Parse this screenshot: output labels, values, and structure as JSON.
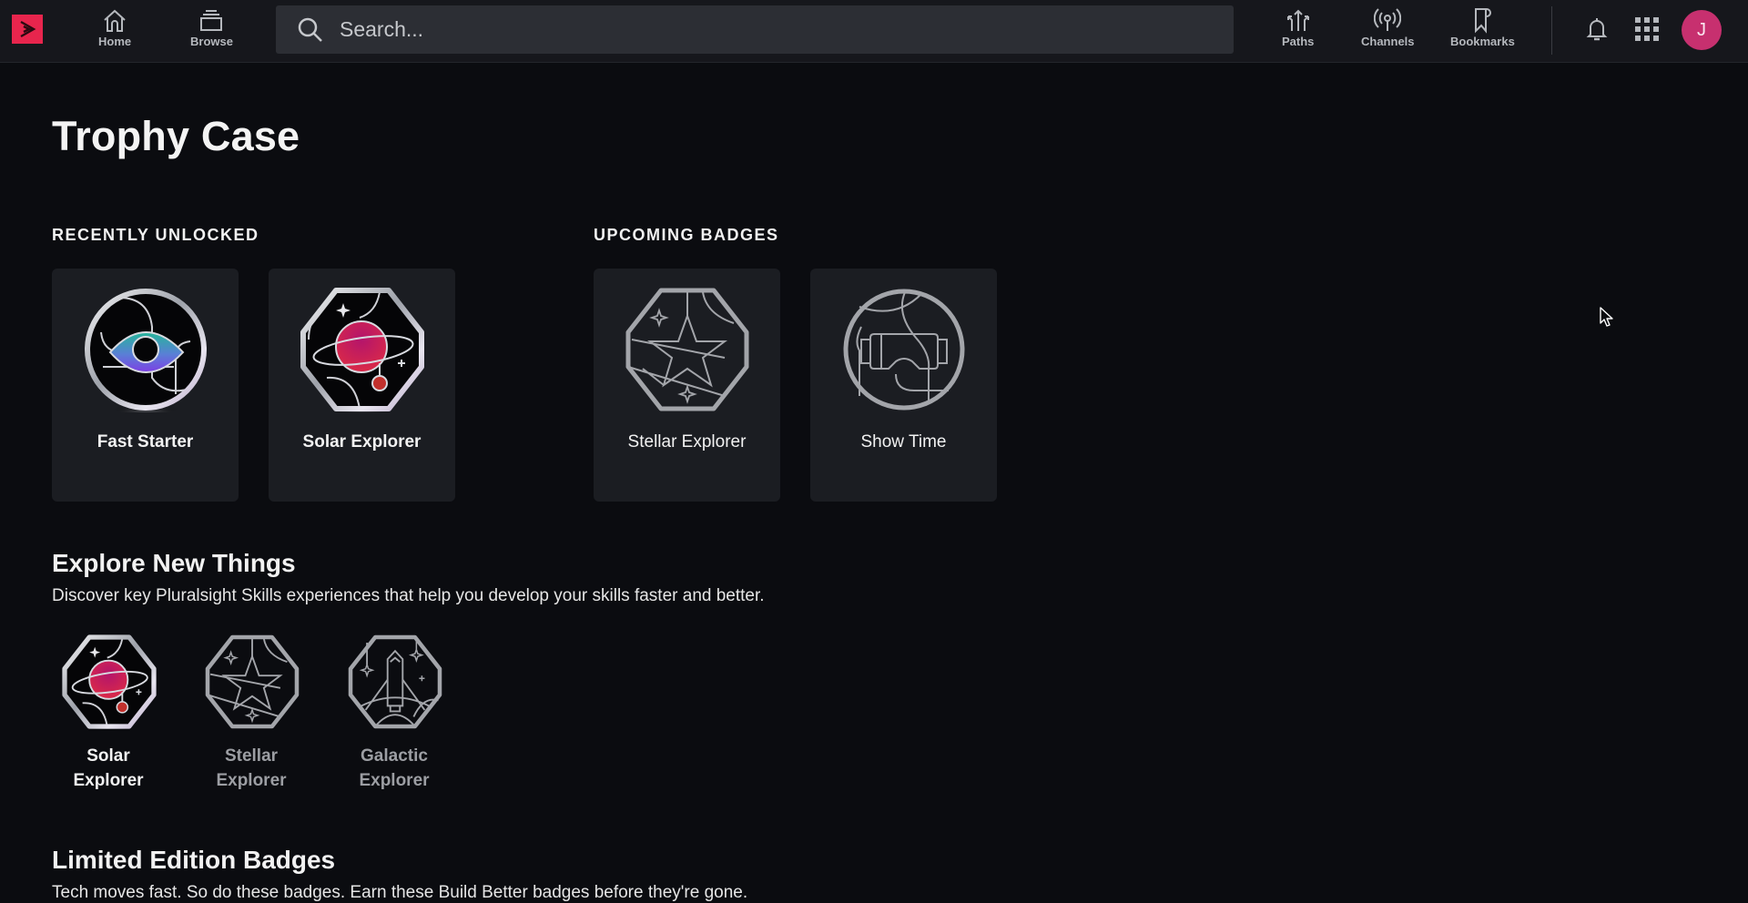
{
  "nav": {
    "logo": "pluralsight-logo",
    "left_items": [
      {
        "label": "Home",
        "icon": "home-icon"
      },
      {
        "label": "Browse",
        "icon": "browse-icon"
      }
    ],
    "search": {
      "placeholder": "Search...",
      "value": ""
    },
    "right_items": [
      {
        "label": "Paths",
        "icon": "paths-icon"
      },
      {
        "label": "Channels",
        "icon": "channels-icon"
      },
      {
        "label": "Bookmarks",
        "icon": "bookmarks-icon"
      }
    ],
    "notifications_icon": "bell-icon",
    "apps_icon": "grid-icon",
    "avatar_initial": "J",
    "colors": {
      "brand": "#e8254d",
      "avatar": "#c7306f"
    }
  },
  "page": {
    "title": "Trophy Case",
    "recently_unlocked": {
      "label": "RECENTLY UNLOCKED",
      "badges": [
        {
          "name": "Fast Starter",
          "state": "unlocked"
        },
        {
          "name": "Solar Explorer",
          "state": "unlocked"
        }
      ]
    },
    "upcoming": {
      "label": "UPCOMING BADGES",
      "badges": [
        {
          "name": "Stellar Explorer",
          "state": "locked"
        },
        {
          "name": "Show Time",
          "state": "locked"
        }
      ]
    },
    "explore": {
      "title": "Explore New Things",
      "description": "Discover key Pluralsight Skills experiences that help you develop your skills faster and better.",
      "badges": [
        {
          "line1": "Solar",
          "line2": "Explorer",
          "state": "unlocked"
        },
        {
          "line1": "Stellar",
          "line2": "Explorer",
          "state": "locked"
        },
        {
          "line1": "Galactic",
          "line2": "Explorer",
          "state": "locked"
        }
      ]
    },
    "limited": {
      "title": "Limited Edition Badges",
      "description": "Tech moves fast. So do these badges. Earn these Build Better badges before they're gone."
    }
  }
}
